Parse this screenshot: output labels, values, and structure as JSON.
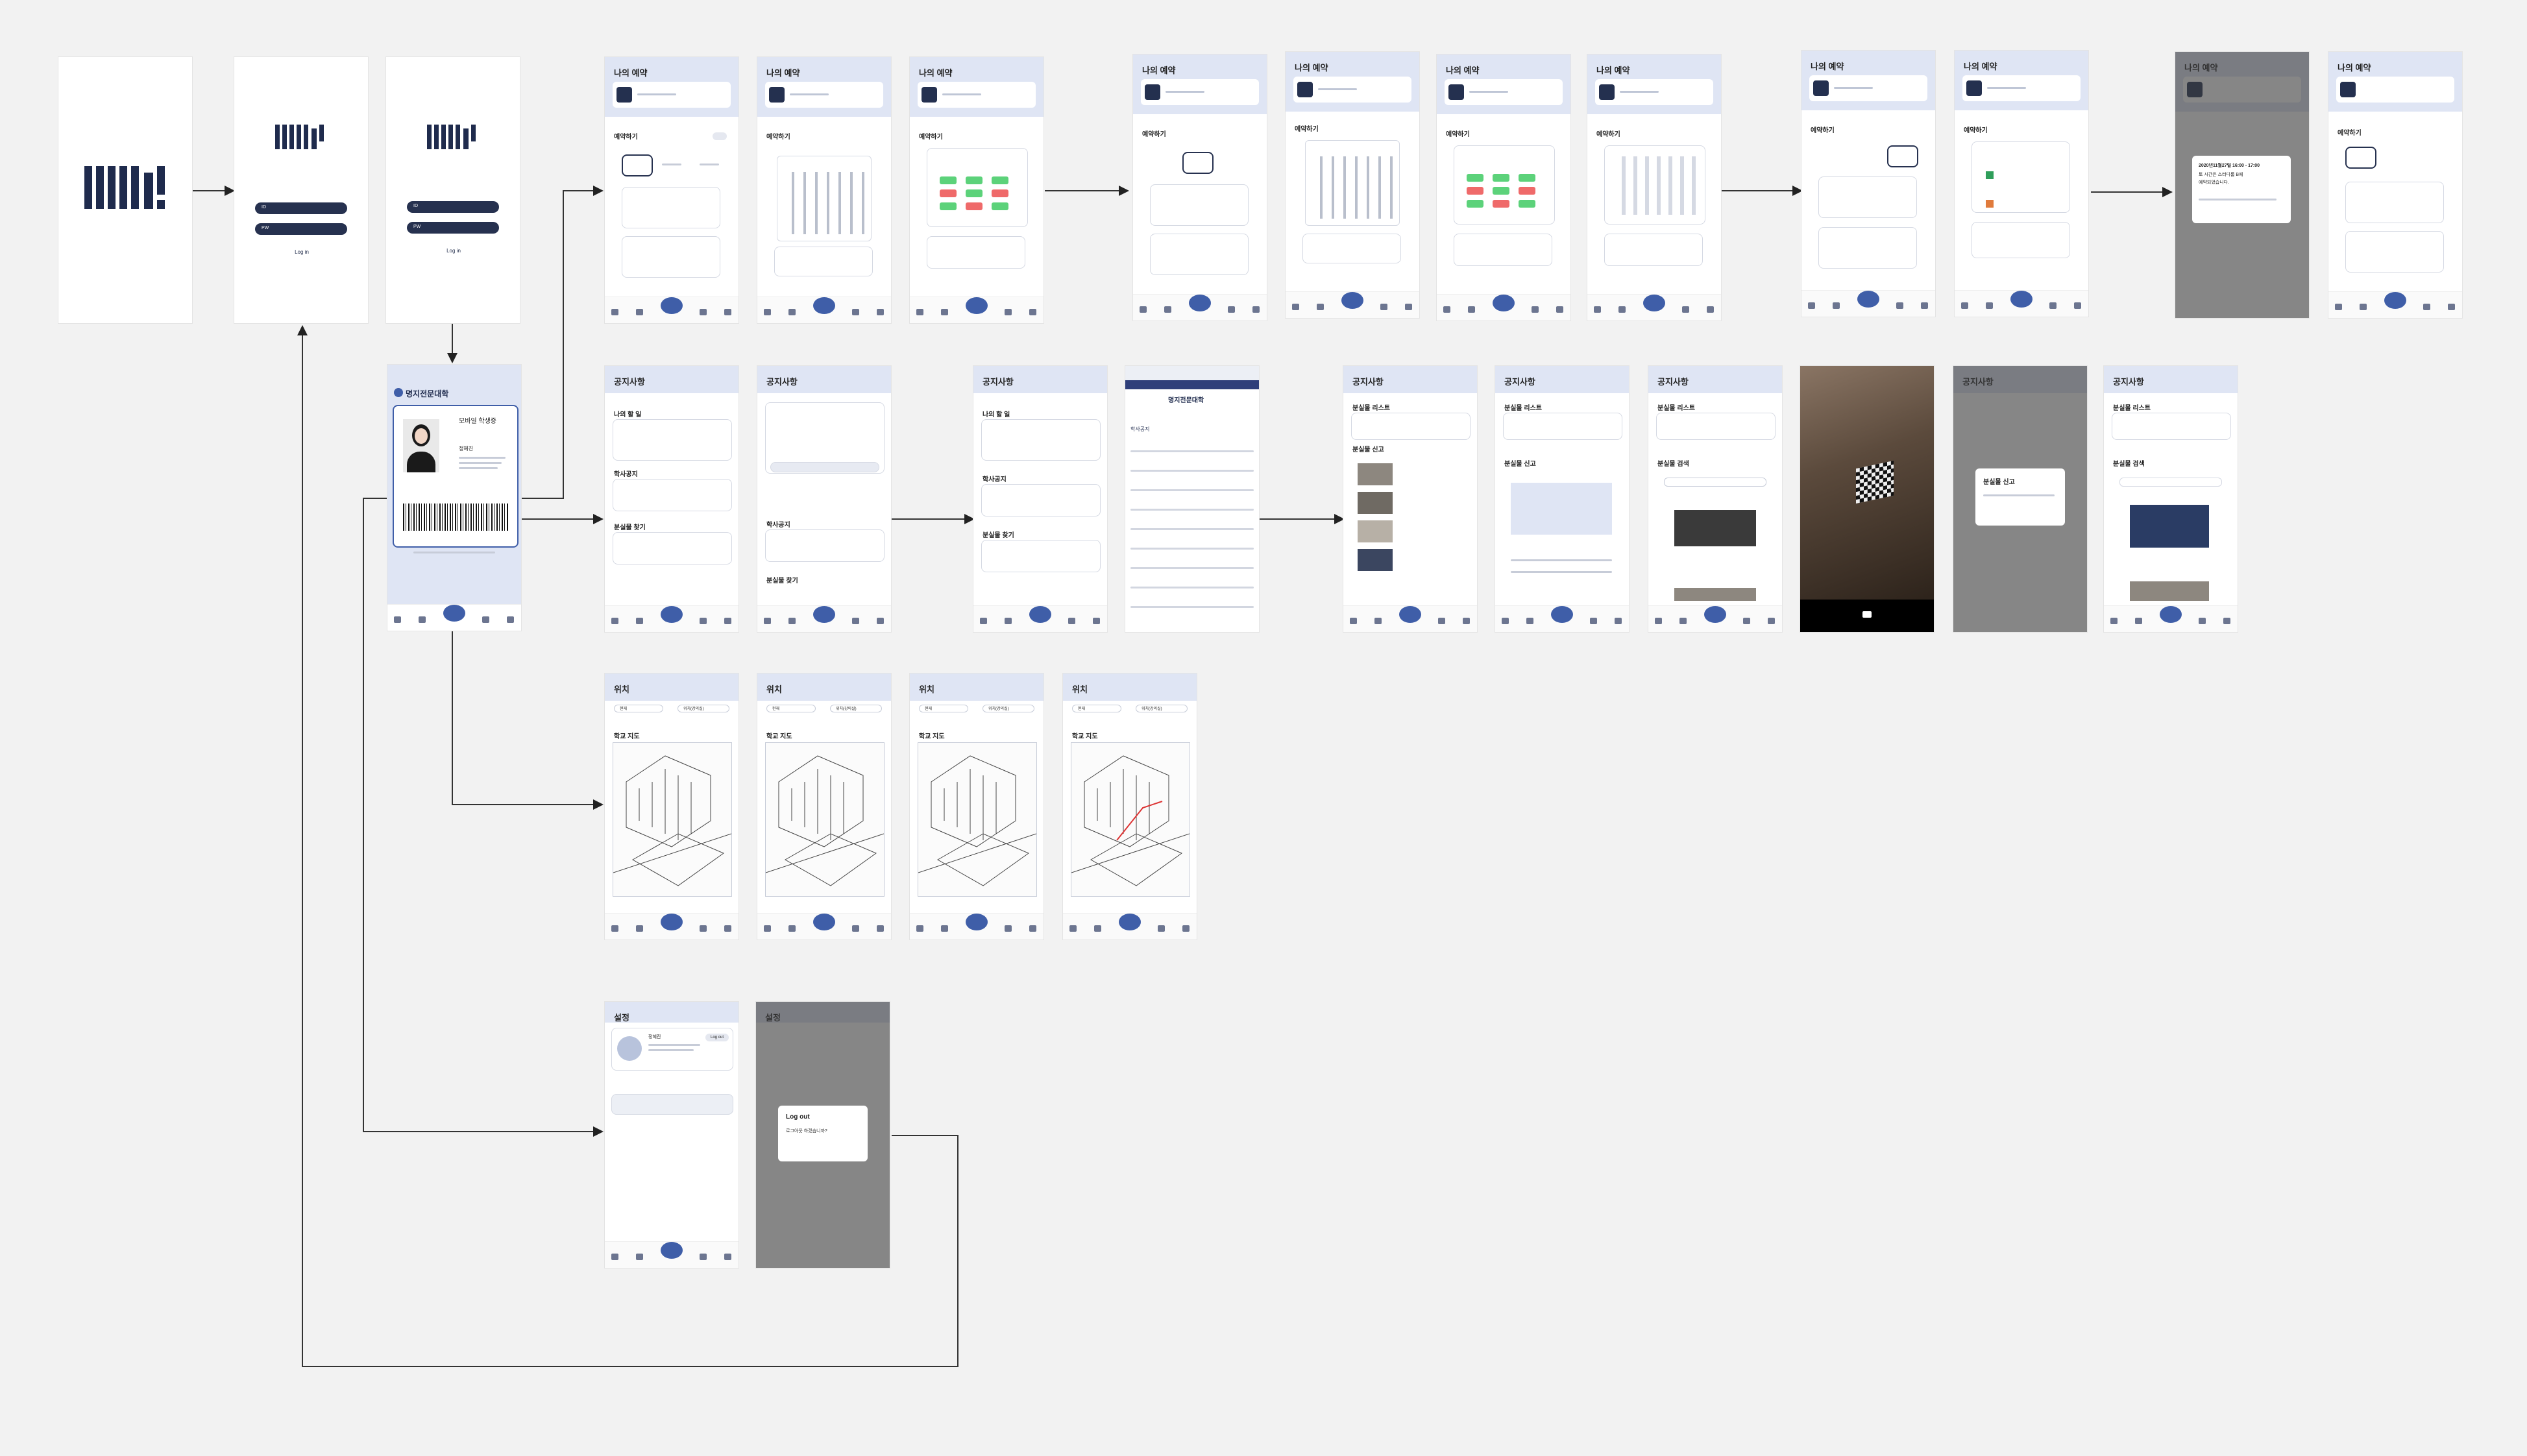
{
  "splash": {
    "caption": ""
  },
  "login": {
    "id_label": "ID",
    "pw_label": "PW",
    "login_button": "Log in"
  },
  "id_card": {
    "university": "명지전문대학",
    "card_title": "모바일 학생증",
    "student_name": "정혜진"
  },
  "reservation": {
    "title": "나의 예약",
    "reserve_section": "예약하기",
    "modal_text_1": "2020년11월27일 16:00 - 17:00",
    "modal_text_2": "토 시간은 스터디룸 B에",
    "modal_text_3": "예약되었습니다."
  },
  "notice": {
    "title": "공지사항",
    "todo_section": "나의 할 일",
    "academic_section": "학사공지",
    "lost_found_section": "분실물 찾기",
    "lost_list_section": "분실물 리스트",
    "lost_report_section": "분실물 신고",
    "lost_search_section": "분실물 검색",
    "report_modal_title": "분실물 신고",
    "website_name": "명지전문대학",
    "website_section": "학사공지"
  },
  "location": {
    "title": "위치",
    "map_section": "학교 지도",
    "search_from": "현재",
    "search_to": "위치(강의실)"
  },
  "settings": {
    "title": "설정",
    "user_name": "정혜진",
    "logout_button": "Log out",
    "modal_title": "Log out",
    "modal_text": "로그아웃 하겠습니까?"
  },
  "colors": {
    "brand_navy": "#1f2b4d",
    "header_tint": "#dfe5f4",
    "accent_blue": "#3f5ea8",
    "slot_green": "#5cd27a",
    "slot_red": "#ef6a6a"
  },
  "icons": {
    "nav": [
      "calendar-icon",
      "id-card-icon",
      "home-icon",
      "notice-icon",
      "search-icon"
    ],
    "camera": "camera-icon"
  }
}
